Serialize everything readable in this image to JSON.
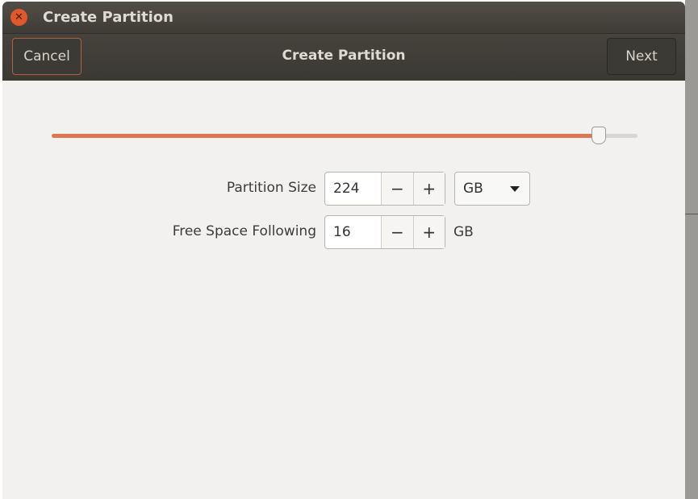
{
  "window": {
    "title": "Create Partition"
  },
  "header": {
    "cancel": "Cancel",
    "title": "Create Partition",
    "next": "Next"
  },
  "slider": {
    "fraction": 0.933,
    "accent": "#e0764f"
  },
  "partition_size": {
    "label": "Partition Size",
    "value": "224",
    "minus": "−",
    "plus": "+",
    "unit": "GB"
  },
  "free_space": {
    "label": "Free Space Following",
    "value": "16",
    "minus": "−",
    "plus": "+",
    "unit": "GB"
  }
}
